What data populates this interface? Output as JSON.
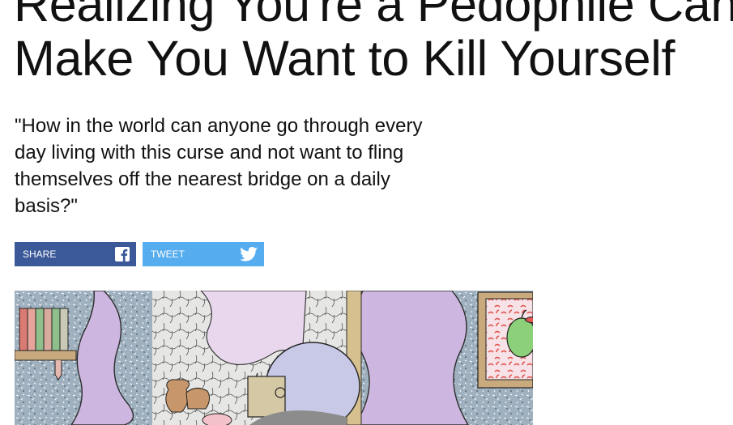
{
  "headline": {
    "line1": "Realizing You're a Pedophile Can",
    "line2": "Make You Want to Kill Yourself"
  },
  "dek": {
    "line1": "\"How in the world can anyone go through every",
    "line2": "day living with this curse and not want to fling",
    "line3": "themselves off the nearest bridge on a daily",
    "line4": "basis?\""
  },
  "share": {
    "facebook_label": "SHARE",
    "facebook_icon": "facebook-icon",
    "twitter_label": "TWEET",
    "twitter_icon": "twitter-bird-icon",
    "colors": {
      "facebook": "#3b5998",
      "twitter": "#55acee"
    }
  },
  "illustration": {
    "description_icon": "article-illustration"
  }
}
